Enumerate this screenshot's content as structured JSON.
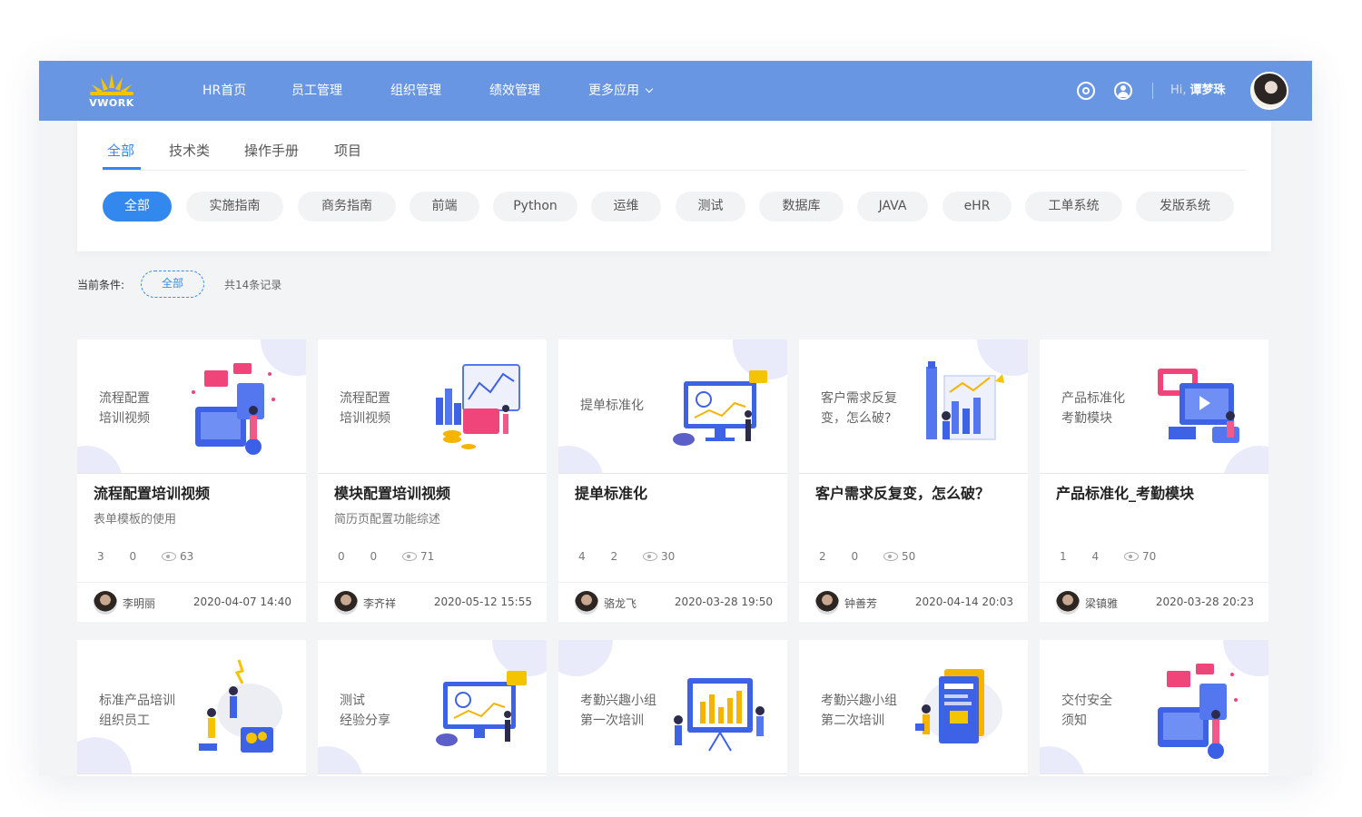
{
  "brand": {
    "logo_text": "VWORK"
  },
  "nav": {
    "items": [
      "HR首页",
      "员工管理",
      "组织管理",
      "绩效管理",
      "更多应用"
    ]
  },
  "header": {
    "greeting_prefix": "Hi,",
    "user_name": "谭梦珠"
  },
  "tabs": [
    "全部",
    "技术类",
    "操作手册",
    "项目"
  ],
  "chips": [
    "全部",
    "实施指南",
    "商务指南",
    "前端",
    "Python",
    "运维",
    "测试",
    "数据库",
    "JAVA",
    "eHR",
    "工单系统",
    "发版系统"
  ],
  "condition": {
    "label": "当前条件:",
    "value": "全部",
    "count": "共14条记录"
  },
  "cards": [
    {
      "cover": [
        "流程配置",
        "培训视频"
      ],
      "title": "流程配置培训视频",
      "subtitle": "表单模板的使用",
      "likes": "3",
      "comments": "0",
      "views": "63",
      "author": "李明丽",
      "date": "2020-04-07 14:40"
    },
    {
      "cover": [
        "流程配置",
        "培训视频"
      ],
      "title": "模块配置培训视频",
      "subtitle": "简历页配置功能综述",
      "likes": "0",
      "comments": "0",
      "views": "71",
      "author": "李齐祥",
      "date": "2020-05-12 15:55"
    },
    {
      "cover": [
        "提单标准化"
      ],
      "title": "提单标准化",
      "subtitle": "",
      "likes": "4",
      "comments": "2",
      "views": "30",
      "author": "骆龙飞",
      "date": "2020-03-28 19:50"
    },
    {
      "cover": [
        "客户需求反复",
        "变，怎么破?"
      ],
      "title": "客户需求反复变，怎么破？",
      "subtitle": "",
      "likes": "2",
      "comments": "0",
      "views": "50",
      "author": "钟善芳",
      "date": "2020-04-14 20:03"
    },
    {
      "cover": [
        "产品标准化",
        "考勤模块"
      ],
      "title": "产品标准化_考勤模块",
      "subtitle": "",
      "likes": "1",
      "comments": "4",
      "views": "70",
      "author": "梁镇雅",
      "date": "2020-03-28 20:23"
    },
    {
      "cover": [
        "标准产品培训",
        "组织员工"
      ]
    },
    {
      "cover": [
        "测试",
        "经验分享"
      ]
    },
    {
      "cover": [
        "考勤兴趣小组",
        "第一次培训"
      ]
    },
    {
      "cover": [
        "考勤兴趣小组",
        "第二次培训"
      ]
    },
    {
      "cover": [
        "交付安全",
        "须知"
      ]
    }
  ],
  "colors": {
    "header_bg": "#6996e2",
    "accent": "#3388ee",
    "page_bg": "#f3f4f6"
  }
}
